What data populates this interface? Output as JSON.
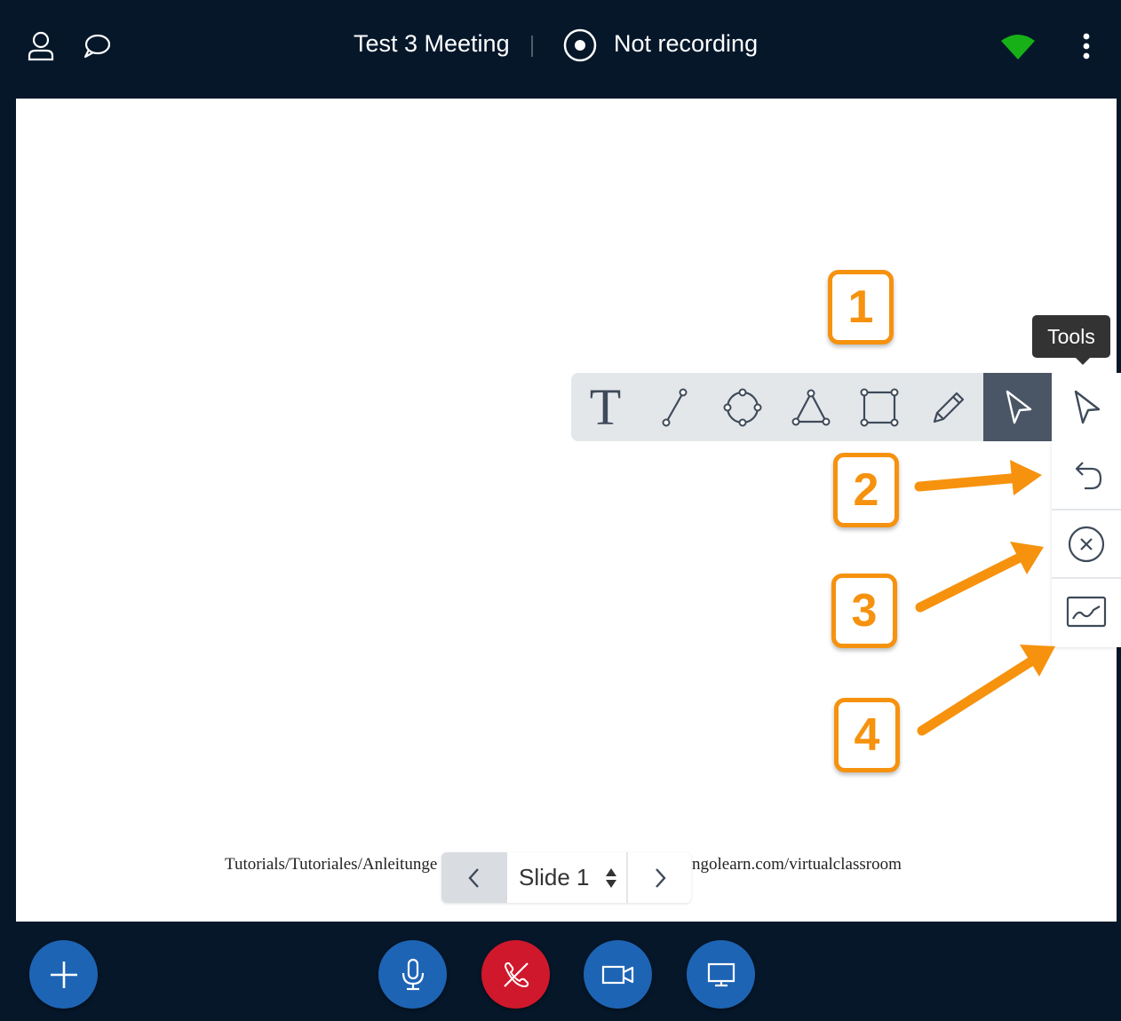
{
  "header": {
    "meeting_title": "Test 3 Meeting",
    "recording_status": "Not recording",
    "icons": [
      "user-icon",
      "chat-icon",
      "record-icon",
      "connection-status-icon",
      "more-options-icon"
    ],
    "connection_color": "#17b117"
  },
  "whiteboard": {
    "footer_left": "Tutorials/Tutoriales/Anleitunge",
    "footer_right": "ngolearn.com/virtualclassroom"
  },
  "toolbar": {
    "tools": [
      "text",
      "line",
      "ellipse",
      "triangle",
      "rectangle",
      "pencil",
      "pointer",
      "tools"
    ],
    "tooltip": "Tools",
    "side_actions": [
      "undo",
      "clear-all",
      "multi-user"
    ]
  },
  "callouts": [
    "1",
    "2",
    "3",
    "4"
  ],
  "slide_nav": {
    "slide_label": "Slide 1"
  },
  "actions": {
    "add_color": "#1e64b4",
    "leave_color": "#d0182c",
    "icons": [
      "plus-icon",
      "microphone-icon",
      "phone-hangup-icon",
      "camera-icon",
      "screen-share-icon"
    ]
  },
  "colors": {
    "background": "#06172a",
    "callout": "#f6920e",
    "toolbar": "#e4e7ea",
    "active_tool": "#4a5665"
  }
}
